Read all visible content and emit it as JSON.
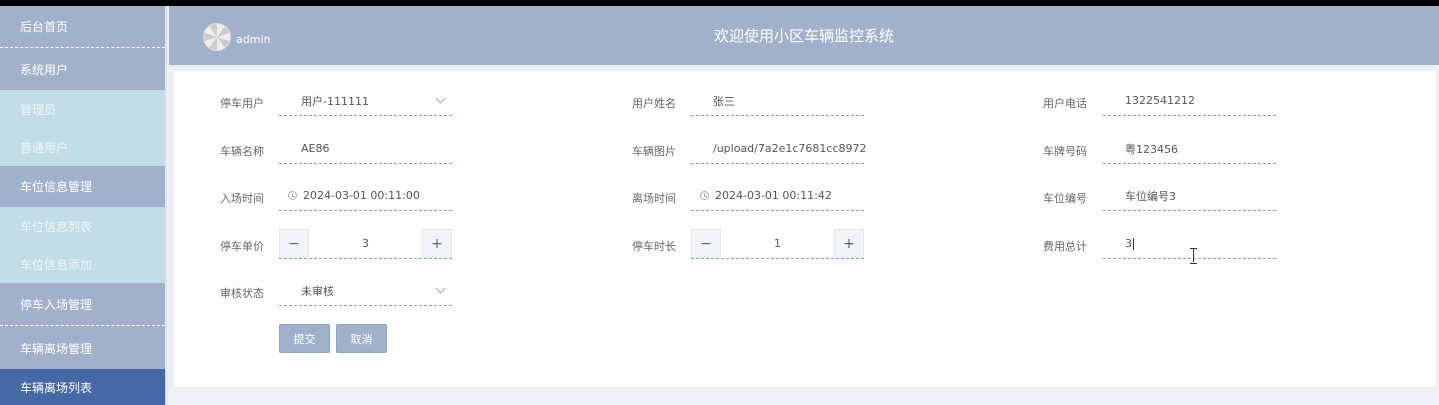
{
  "sidebar": {
    "items": [
      {
        "label": "后台首页"
      },
      {
        "label": "系统用户"
      },
      {
        "label": "管理员"
      },
      {
        "label": "普通用户"
      },
      {
        "label": "车位信息管理"
      },
      {
        "label": "车位信息列表"
      },
      {
        "label": "车位信息添加"
      },
      {
        "label": "停车入场管理"
      },
      {
        "label": "车辆离场管理"
      },
      {
        "label": "车辆离场列表"
      }
    ]
  },
  "header": {
    "username": "admin",
    "title": "欢迎使用小区车辆监控系统"
  },
  "form": {
    "user": {
      "label": "停车用户",
      "value": "用户-111111"
    },
    "user_name": {
      "label": "用户姓名",
      "value": "张三"
    },
    "user_phone": {
      "label": "用户电话",
      "value": "1322541212"
    },
    "vehicle_name": {
      "label": "车辆名称",
      "value": "AE86"
    },
    "vehicle_image": {
      "label": "车辆图片",
      "value": "/upload/7a2e1c7681cc8972"
    },
    "plate_number": {
      "label": "车牌号码",
      "value": "粤123456"
    },
    "entry_time": {
      "label": "入场时间",
      "value": "2024-03-01 00:11:00"
    },
    "exit_time": {
      "label": "离场时间",
      "value": "2024-03-01 00:11:42"
    },
    "space_number": {
      "label": "车位编号",
      "value": "车位编号3"
    },
    "unit_price": {
      "label": "停车单价",
      "value": "3",
      "minus": "−",
      "plus": "+"
    },
    "duration": {
      "label": "停车时长",
      "value": "1",
      "minus": "−",
      "plus": "+"
    },
    "total_fee": {
      "label": "费用总计",
      "value": "3"
    },
    "review_status": {
      "label": "审核状态",
      "value": "未审核"
    }
  },
  "buttons": {
    "submit": "提交",
    "cancel": "取消"
  }
}
